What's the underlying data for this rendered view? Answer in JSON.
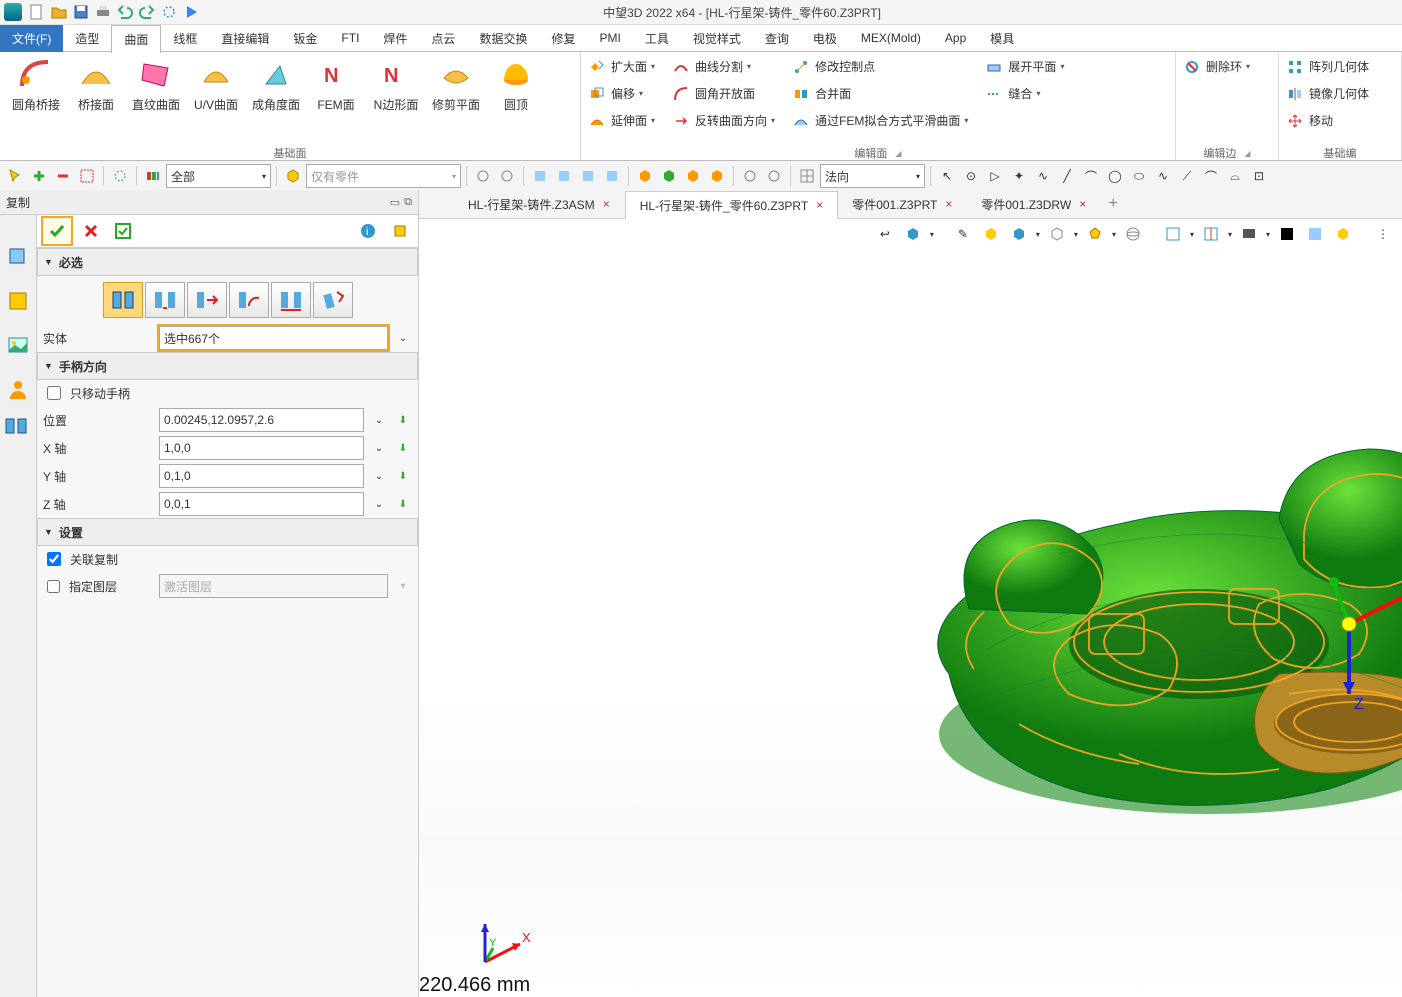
{
  "app": {
    "title_text": "中望3D 2022 x64 - [HL-行星架-铸件_零件60.Z3PRT]"
  },
  "menubar": {
    "file": "文件(F)",
    "items": [
      "造型",
      "曲面",
      "线框",
      "直接编辑",
      "钣金",
      "FTI",
      "焊件",
      "点云",
      "数据交换",
      "修复",
      "PMI",
      "工具",
      "视觉样式",
      "查询",
      "电极",
      "MEX(Mold)",
      "App",
      "模具"
    ],
    "active_index": 1
  },
  "ribbon": {
    "group1": {
      "label": "基础面",
      "buttons": [
        "圆角桥接",
        "桥接面",
        "直纹曲面",
        "U/V曲面",
        "成角度面",
        "FEM面",
        "N边形面",
        "修剪平面",
        "圆顶"
      ]
    },
    "group2": {
      "label": "编辑面",
      "col1": [
        "扩大面",
        "偏移",
        "延伸面"
      ],
      "col2": [
        "曲线分割",
        "圆角开放面",
        "反转曲面方向"
      ],
      "col3": [
        "修改控制点",
        "合并面",
        "通过FEM拟合方式平滑曲面"
      ],
      "col4": [
        "展开平面",
        "缝合"
      ]
    },
    "group3": {
      "label": "编辑边",
      "items": [
        "删除环"
      ]
    },
    "group4": {
      "label": "基础编",
      "items": [
        "阵列几何体",
        "镜像几何体",
        "移动"
      ]
    }
  },
  "toolbar2": {
    "combo1": "全部",
    "combo2": "仅有零件",
    "combo3": "法向"
  },
  "panel": {
    "title": "复制",
    "section_required": "必选",
    "entity_label": "实体",
    "entity_value": "选中667个",
    "section_handle": "手柄方向",
    "only_move_handle": "只移动手柄",
    "position_label": "位置",
    "position_value": "0.00245,12.0957,2.6",
    "x_label": "X 轴",
    "x_value": "1,0,0",
    "y_label": "Y 轴",
    "y_value": "0,1,0",
    "z_label": "Z 轴",
    "z_value": "0,0,1",
    "section_settings": "设置",
    "assoc_copy": "关联复制",
    "spec_layer": "指定图层",
    "layer_value": "激活图层"
  },
  "doctabs": {
    "tabs": [
      {
        "label": "HL-行星架-铸件.Z3ASM"
      },
      {
        "label": "HL-行星架-铸件_零件60.Z3PRT"
      },
      {
        "label": "零件001.Z3PRT"
      },
      {
        "label": "零件001.Z3DRW"
      }
    ],
    "active_index": 1
  },
  "viewport": {
    "dimension": "220.466 mm",
    "axes": {
      "x": "X",
      "y": "Y",
      "z": "Z",
      "z2": "Z"
    }
  }
}
